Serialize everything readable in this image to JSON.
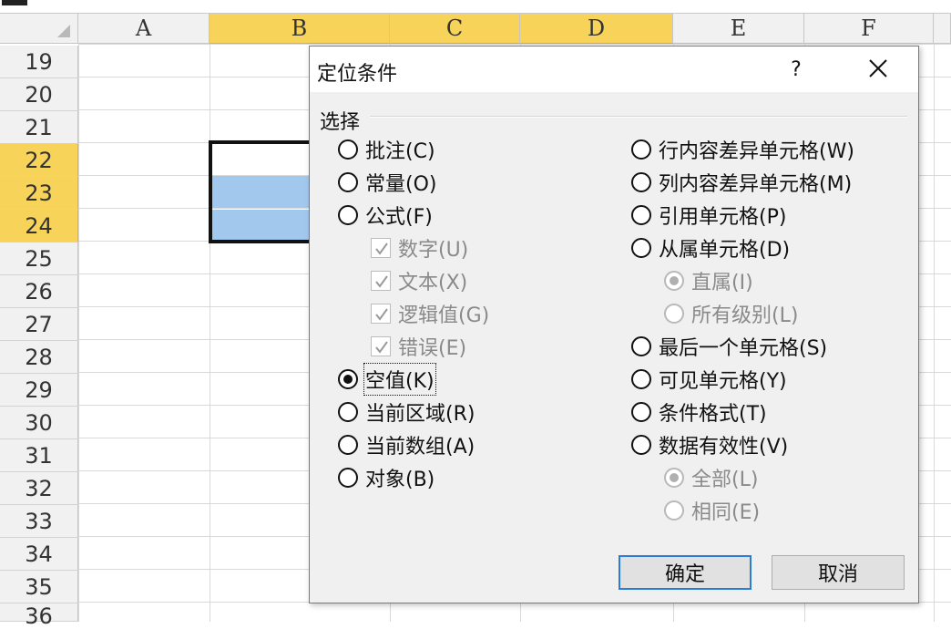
{
  "spreadsheet": {
    "columns": [
      "A",
      "B",
      "C",
      "D",
      "E",
      "F"
    ],
    "rows": [
      "19",
      "20",
      "21",
      "22",
      "23",
      "24",
      "25",
      "26",
      "27",
      "28",
      "29",
      "30",
      "31",
      "32",
      "33",
      "34",
      "35",
      "36"
    ],
    "selected_columns": [
      "B",
      "C",
      "D"
    ],
    "selected_rows": [
      "22",
      "23",
      "24"
    ],
    "accent_color": "#f8d35a",
    "selection_fill": "#a3c8ee"
  },
  "dialog": {
    "title": "定位条件",
    "help_label": "?",
    "group_label": "选择",
    "left_options": [
      {
        "label": "批注(C)",
        "type": "radio",
        "checked": false,
        "enabled": true
      },
      {
        "label": "常量(O)",
        "type": "radio",
        "checked": false,
        "enabled": true
      },
      {
        "label": "公式(F)",
        "type": "radio",
        "checked": false,
        "enabled": true
      },
      {
        "label": "数字(U)",
        "type": "checkbox",
        "checked": true,
        "enabled": false
      },
      {
        "label": "文本(X)",
        "type": "checkbox",
        "checked": true,
        "enabled": false
      },
      {
        "label": "逻辑值(G)",
        "type": "checkbox",
        "checked": true,
        "enabled": false
      },
      {
        "label": "错误(E)",
        "type": "checkbox",
        "checked": true,
        "enabled": false
      },
      {
        "label": "空值(K)",
        "type": "radio",
        "checked": true,
        "enabled": true
      },
      {
        "label": "当前区域(R)",
        "type": "radio",
        "checked": false,
        "enabled": true
      },
      {
        "label": "当前数组(A)",
        "type": "radio",
        "checked": false,
        "enabled": true
      },
      {
        "label": "对象(B)",
        "type": "radio",
        "checked": false,
        "enabled": true
      }
    ],
    "right_options": [
      {
        "label": "行内容差异单元格(W)",
        "type": "radio",
        "checked": false,
        "enabled": true
      },
      {
        "label": "列内容差异单元格(M)",
        "type": "radio",
        "checked": false,
        "enabled": true
      },
      {
        "label": "引用单元格(P)",
        "type": "radio",
        "checked": false,
        "enabled": true
      },
      {
        "label": "从属单元格(D)",
        "type": "radio",
        "checked": false,
        "enabled": true
      },
      {
        "label": "直属(I)",
        "type": "radio",
        "checked": true,
        "enabled": false
      },
      {
        "label": "所有级别(L)",
        "type": "radio",
        "checked": false,
        "enabled": false
      },
      {
        "label": "最后一个单元格(S)",
        "type": "radio",
        "checked": false,
        "enabled": true
      },
      {
        "label": "可见单元格(Y)",
        "type": "radio",
        "checked": false,
        "enabled": true
      },
      {
        "label": "条件格式(T)",
        "type": "radio",
        "checked": false,
        "enabled": true
      },
      {
        "label": "数据有效性(V)",
        "type": "radio",
        "checked": false,
        "enabled": true
      },
      {
        "label": "全部(L)",
        "type": "radio",
        "checked": true,
        "enabled": false
      },
      {
        "label": "相同(E)",
        "type": "radio",
        "checked": false,
        "enabled": false
      }
    ],
    "ok_label": "确定",
    "cancel_label": "取消",
    "icons": {
      "close": "close-icon",
      "help": "help-icon",
      "check": "checkmark-icon"
    }
  }
}
